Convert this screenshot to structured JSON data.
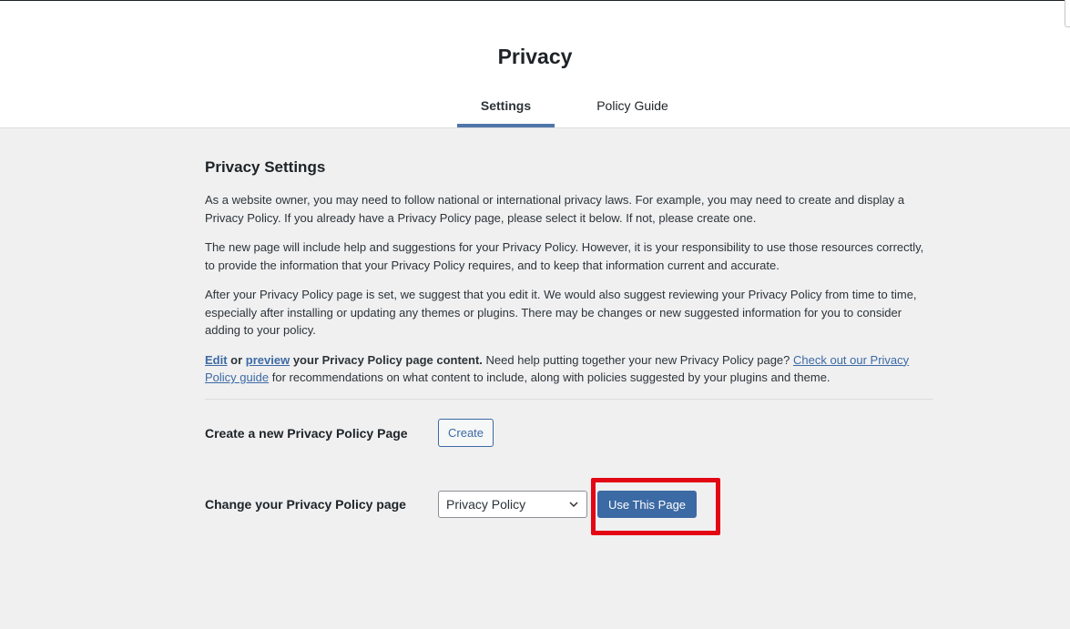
{
  "header": {
    "title": "Privacy",
    "tabs": [
      {
        "label": "Settings",
        "active": true
      },
      {
        "label": "Policy Guide",
        "active": false
      }
    ]
  },
  "main": {
    "heading": "Privacy Settings",
    "paragraphs": [
      "As a website owner, you may need to follow national or international privacy laws. For example, you may need to create and display a Privacy Policy. If you already have a Privacy Policy page, please select it below. If not, please create one.",
      "The new page will include help and suggestions for your Privacy Policy. However, it is your responsibility to use those resources correctly, to provide the information that your Privacy Policy requires, and to keep that information current and accurate.",
      "After your Privacy Policy page is set, we suggest that you edit it. We would also suggest reviewing your Privacy Policy from time to time, especially after installing or updating any themes or plugins. There may be changes or new suggested information for you to consider adding to your policy."
    ],
    "edit_line": {
      "edit_link": "Edit",
      "or": " or ",
      "preview_link": "preview",
      "bold_rest": " your Privacy Policy page content.",
      "help_text": " Need help putting together your new Privacy Policy page? ",
      "guide_link": "Check out our Privacy Policy guide",
      "tail": " for recommendations on what content to include, along with policies suggested by your plugins and theme."
    },
    "create_row": {
      "label": "Create a new Privacy Policy Page",
      "button": "Create"
    },
    "change_row": {
      "label": "Change your Privacy Policy page",
      "selected_page": "Privacy Policy",
      "button": "Use This Page"
    }
  },
  "colors": {
    "accent": "#3c6aa4",
    "highlight": "#e30613",
    "background": "#f0f0f1"
  }
}
